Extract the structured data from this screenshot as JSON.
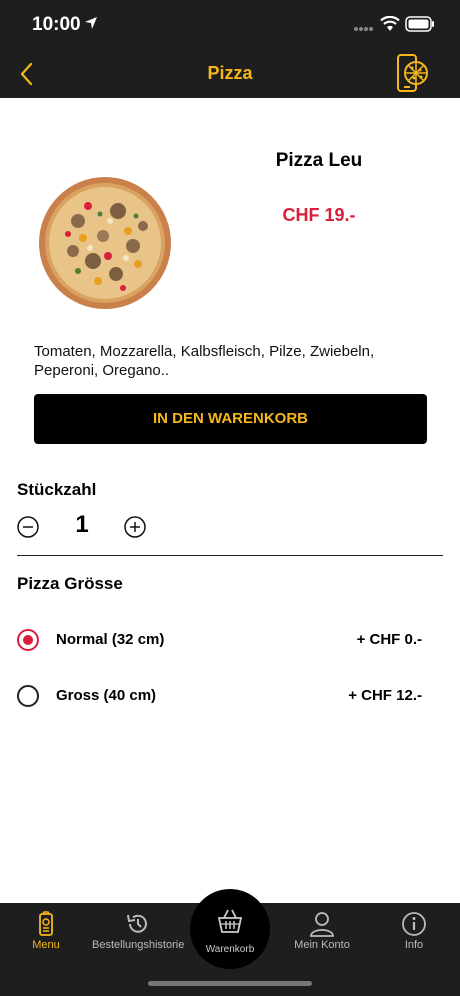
{
  "status_bar": {
    "time": "10:00"
  },
  "nav": {
    "title": "Pizza",
    "back_icon": "chevron-left-icon",
    "right_icon": "phone-pizza-icon"
  },
  "product": {
    "name": "Pizza Leu",
    "price": "CHF 19.-",
    "description": "Tomaten, Mozzarella, Kalbsfleisch, Pilze, Zwiebeln, Peperoni, Oregano..",
    "add_to_cart_label": "IN DEN WARENKORB"
  },
  "quantity": {
    "heading": "Stückzahl",
    "value": "1"
  },
  "size": {
    "heading": "Pizza Grösse",
    "options": [
      {
        "label": "Normal (32 cm)",
        "price": "+ CHF 0.-",
        "selected": true
      },
      {
        "label": "Gross (40 cm)",
        "price": "+ CHF 12.-",
        "selected": false
      }
    ]
  },
  "tabs": [
    {
      "label": "Menu",
      "icon": "menu-icon",
      "active": true
    },
    {
      "label": "Bestellungshistorie",
      "icon": "history-icon",
      "active": false
    },
    {
      "label": "Warenkorb",
      "icon": "basket-icon",
      "active": false
    },
    {
      "label": "Mein Konto",
      "icon": "user-icon",
      "active": false
    },
    {
      "label": "Info",
      "icon": "info-icon",
      "active": false
    }
  ],
  "colors": {
    "accent": "#f5b719",
    "price": "#d8203d",
    "bar": "#1e1e1e"
  }
}
